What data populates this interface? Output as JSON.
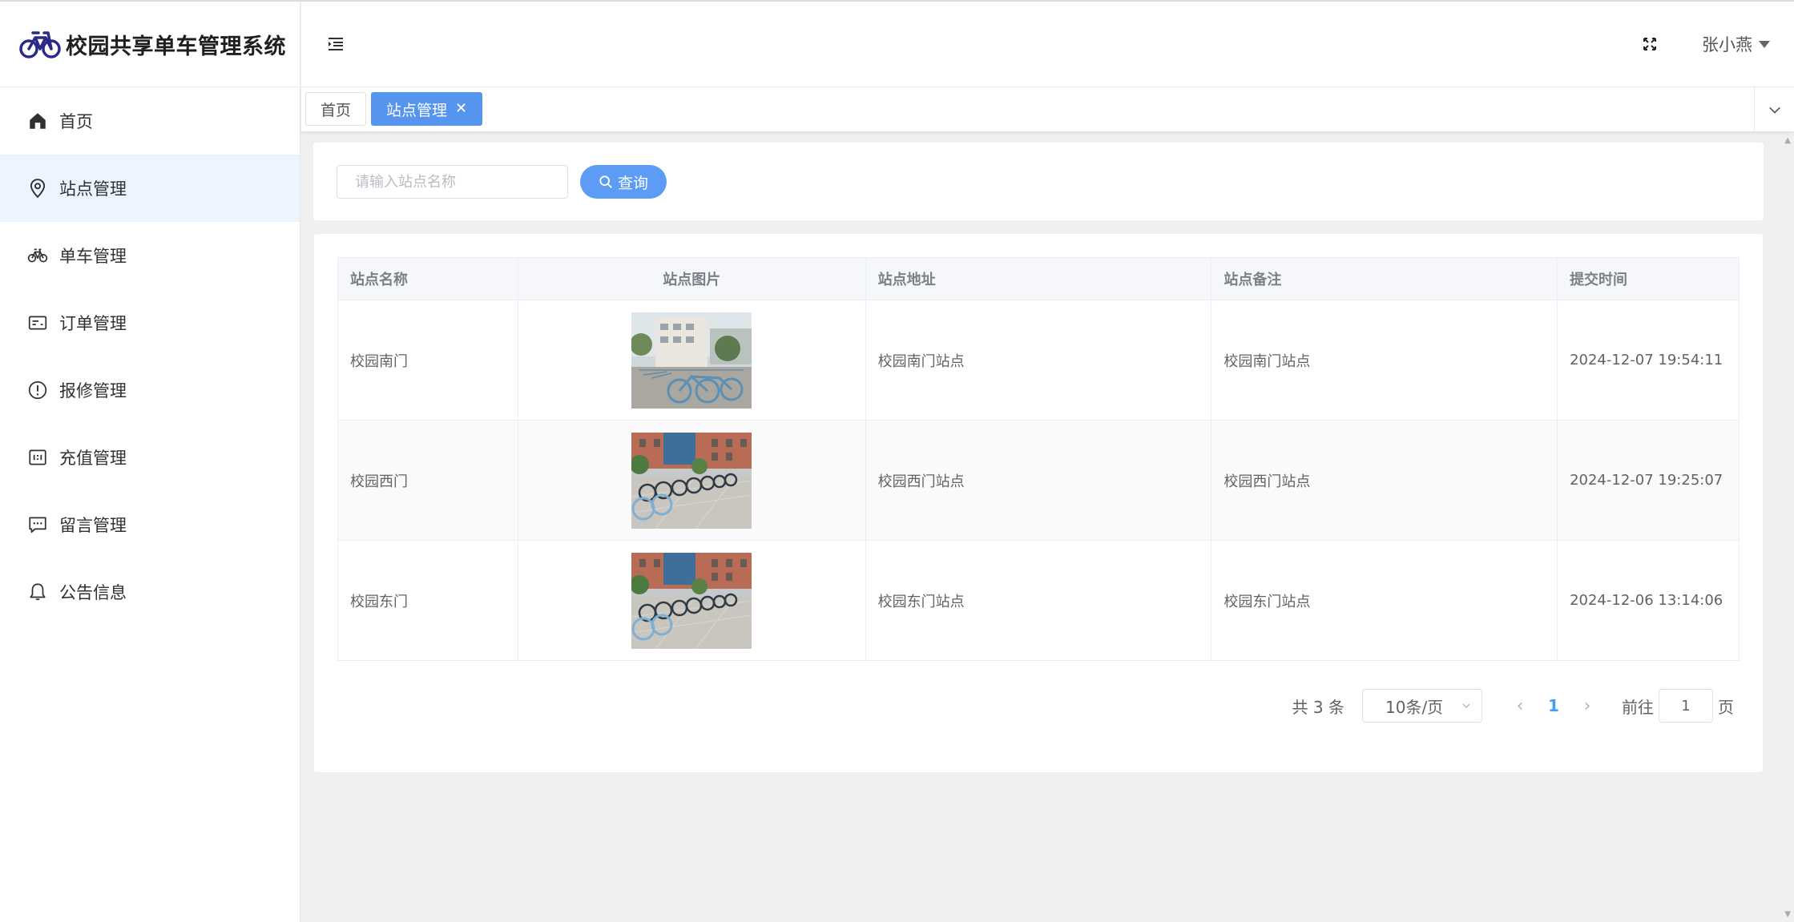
{
  "app": {
    "title": "校园共享单车管理系统"
  },
  "header": {
    "user_name": "张小燕"
  },
  "sidebar": {
    "items": [
      {
        "label": "首页",
        "icon": "home-icon"
      },
      {
        "label": "站点管理",
        "icon": "location-pin-icon",
        "active": true
      },
      {
        "label": "单车管理",
        "icon": "bicycle-icon"
      },
      {
        "label": "订单管理",
        "icon": "order-card-icon"
      },
      {
        "label": "报修管理",
        "icon": "warning-circle-icon"
      },
      {
        "label": "充值管理",
        "icon": "wallet-icon"
      },
      {
        "label": "留言管理",
        "icon": "chat-bubble-icon"
      },
      {
        "label": "公告信息",
        "icon": "bell-icon"
      }
    ]
  },
  "tabs": [
    {
      "label": "首页"
    },
    {
      "label": "站点管理",
      "active": true
    }
  ],
  "search": {
    "placeholder": "请输入站点名称",
    "value": "",
    "button_label": "查询"
  },
  "table": {
    "columns": [
      "站点名称",
      "站点图片",
      "站点地址",
      "站点备注",
      "提交时间"
    ],
    "rows": [
      {
        "name": "校园南门",
        "address": "校园南门站点",
        "remark": "校园南门站点",
        "time": "2024-12-07 19:54:11"
      },
      {
        "name": "校园西门",
        "address": "校园西门站点",
        "remark": "校园西门站点",
        "time": "2024-12-07 19:25:07"
      },
      {
        "name": "校园东门",
        "address": "校园东门站点",
        "remark": "校园东门站点",
        "time": "2024-12-06 13:14:06"
      }
    ]
  },
  "pagination": {
    "total_text": "共 3 条",
    "page_size": "10条/页",
    "current_page": "1",
    "goto_prefix": "前往",
    "goto_value": "1",
    "goto_suffix": "页"
  },
  "colors": {
    "primary": "#5c9cf5",
    "active_menu_bg": "#ecf5ff",
    "page_bg": "#f0f0f0"
  }
}
